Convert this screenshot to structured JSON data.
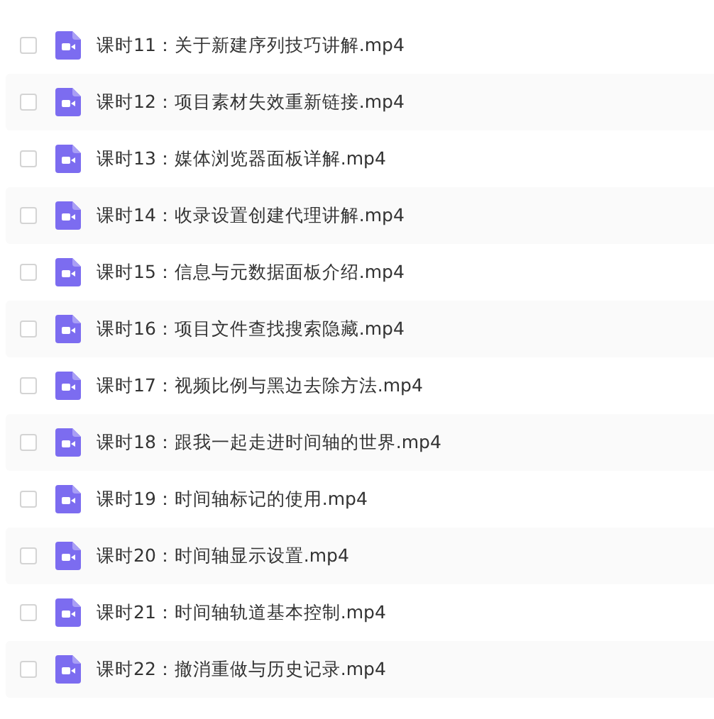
{
  "files": [
    {
      "name": "课时11：关于新建序列技巧讲解.mp4",
      "checked": false
    },
    {
      "name": "课时12：项目素材失效重新链接.mp4",
      "checked": false
    },
    {
      "name": "课时13：媒体浏览器面板详解.mp4",
      "checked": false
    },
    {
      "name": "课时14：收录设置创建代理讲解.mp4",
      "checked": false
    },
    {
      "name": "课时15：信息与元数据面板介绍.mp4",
      "checked": false
    },
    {
      "name": "课时16：项目文件查找搜索隐藏.mp4",
      "checked": false
    },
    {
      "name": "课时17：视频比例与黑边去除方法.mp4",
      "checked": false
    },
    {
      "name": "课时18：跟我一起走进时间轴的世界.mp4",
      "checked": false
    },
    {
      "name": "课时19：时间轴标记的使用.mp4",
      "checked": false
    },
    {
      "name": "课时20：时间轴显示设置.mp4",
      "checked": false
    },
    {
      "name": "课时21：时间轴轨道基本控制.mp4",
      "checked": false
    },
    {
      "name": "课时22：撤消重做与历史记录.mp4",
      "checked": false
    }
  ]
}
